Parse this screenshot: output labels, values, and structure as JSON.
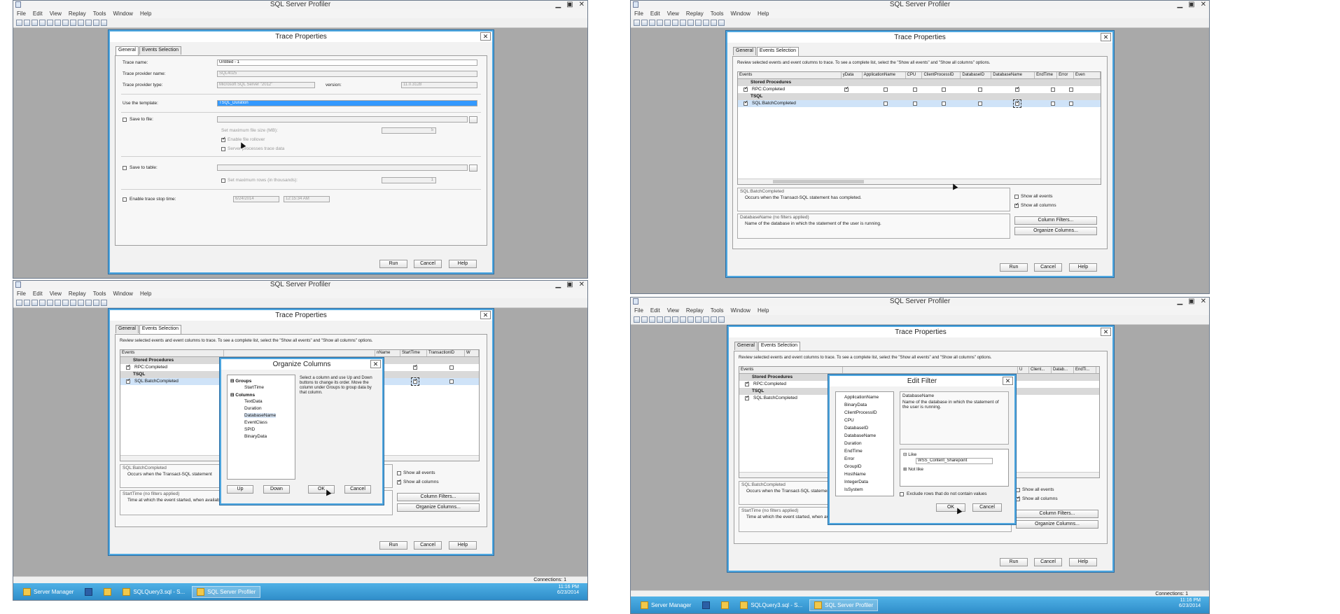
{
  "app": {
    "title": "SQL Server Profiler",
    "menu": [
      "File",
      "Edit",
      "View",
      "Replay",
      "Tools",
      "Window",
      "Help"
    ]
  },
  "trace_properties": {
    "title": "Trace Properties",
    "tabs": [
      "General",
      "Events Selection"
    ],
    "general": {
      "trace_name_label": "Trace name:",
      "trace_name_value": "Untitled - 1",
      "provider_name_label": "Trace provider name:",
      "provider_name_value": "SQL4025",
      "provider_type_label": "Trace provider type:",
      "provider_type_value": "Microsoft SQL Server \"2012\"",
      "version_label": "version:",
      "version_value": "11.0.3128",
      "template_label": "Use the template:",
      "template_value": "TSQL_Duration",
      "save_to_file": "Save to file:",
      "max_file_size": "Set maximum file size (MB):",
      "max_file_size_value": "5",
      "enable_rollover": "Enable file rollover",
      "server_processes": "Server processes trace data",
      "save_to_table": "Save to table:",
      "max_rows": "Set maximum rows (in thousands):",
      "max_rows_value": "1",
      "enable_stop_time": "Enable trace stop time:",
      "stop_date": "6/24/2014",
      "stop_time": "12:15:34 AM"
    },
    "events": {
      "instructions": "Review selected events and event columns to trace. To see a complete list, select the \"Show all events\" and \"Show all columns\" options.",
      "columns_header": [
        "Events",
        "yData",
        "ApplicationName",
        "CPU",
        "ClientProcessID",
        "DatabaseID",
        "DatabaseName",
        "EndTime",
        "Error",
        "Even"
      ],
      "cat_stored_procedures": "Stored Procedures",
      "rpc_completed": "RPC:Completed",
      "cat_tsql": "TSQL",
      "sql_batch_completed": "SQL:BatchCompleted",
      "desc_title": "SQL:BatchCompleted",
      "desc_text": "Occurs when the Transact-SQL statement has completed.",
      "desc_text_short": "Occurs when the Transact-SQL statement",
      "col_title": "DatabaseName (no filters applied)",
      "col_text": "Name of the database in which the statement of the user is running.",
      "col_title_starttime": "StartTime (no filters applied)",
      "col_text_starttime": "Time at which the event started, when available.",
      "show_all_events": "Show all events",
      "show_all_columns": "Show all columns",
      "column_filters": "Column Filters...",
      "organize_columns": "Organize Columns...",
      "cols_bl": [
        "nName",
        "StartTime",
        "TransactionID",
        "W"
      ],
      "cols_br": [
        "U",
        "Client...",
        "Datab...",
        "EndTi..."
      ]
    },
    "buttons": {
      "run": "Run",
      "cancel": "Cancel",
      "help": "Help"
    }
  },
  "organize_columns": {
    "title": "Organize Columns",
    "groups": "Groups",
    "starttime": "StartTime",
    "columns": "Columns",
    "items": [
      "TextData",
      "Duration",
      "DatabaseName",
      "EventClass",
      "SPID",
      "BinaryData"
    ],
    "help": "Select a column and use Up and Down buttons to change its order. Move the column under Groups to group data by that column.",
    "up": "Up",
    "down": "Down",
    "ok": "OK",
    "cancel": "Cancel"
  },
  "edit_filter": {
    "title": "Edit Filter",
    "columns": [
      "ApplicationName",
      "BinaryData",
      "ClientProcessID",
      "CPU",
      "DatabaseID",
      "DatabaseName",
      "Duration",
      "EndTime",
      "Error",
      "GroupID",
      "HostName",
      "IntegerData",
      "IsSystem"
    ],
    "heading": "DatabaseName",
    "description": "Name of the database in which the statement of the user is running.",
    "like": "Like",
    "like_value": "WSS_Content_Sharepoint",
    "not_like": "Not like",
    "exclude": "Exclude rows that do not contain values",
    "ok": "OK",
    "cancel": "Cancel"
  },
  "taskbar": {
    "items": [
      "Server Manager",
      "SQLQuery3.sql - S...",
      "SQL Server Profiler"
    ],
    "time": "11:16 PM",
    "date": "6/23/2014",
    "date2": "6/23/2014"
  },
  "status": {
    "connections": "Connections: 1"
  }
}
